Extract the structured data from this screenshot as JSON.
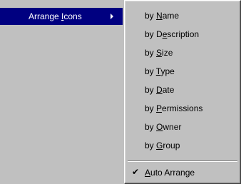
{
  "parent_menu": {
    "item": {
      "prefix": "Arrange ",
      "mnemonic": "I",
      "suffix": "cons",
      "icon": "chevron-right-icon"
    }
  },
  "submenu": {
    "items": [
      {
        "prefix": "by ",
        "mnemonic": "N",
        "suffix": "ame"
      },
      {
        "prefix": "by D",
        "mnemonic": "e",
        "suffix": "scription"
      },
      {
        "prefix": "by ",
        "mnemonic": "S",
        "suffix": "ize"
      },
      {
        "prefix": "by ",
        "mnemonic": "T",
        "suffix": "ype"
      },
      {
        "prefix": "by ",
        "mnemonic": "D",
        "suffix": "ate"
      },
      {
        "prefix": "by ",
        "mnemonic": "P",
        "suffix": "ermissions"
      },
      {
        "prefix": "by ",
        "mnemonic": "O",
        "suffix": "wner"
      },
      {
        "prefix": "by ",
        "mnemonic": "G",
        "suffix": "roup"
      }
    ],
    "auto_arrange": {
      "check": "✔",
      "prefix": "",
      "mnemonic": "A",
      "suffix": "uto Arrange",
      "checked": true
    }
  }
}
